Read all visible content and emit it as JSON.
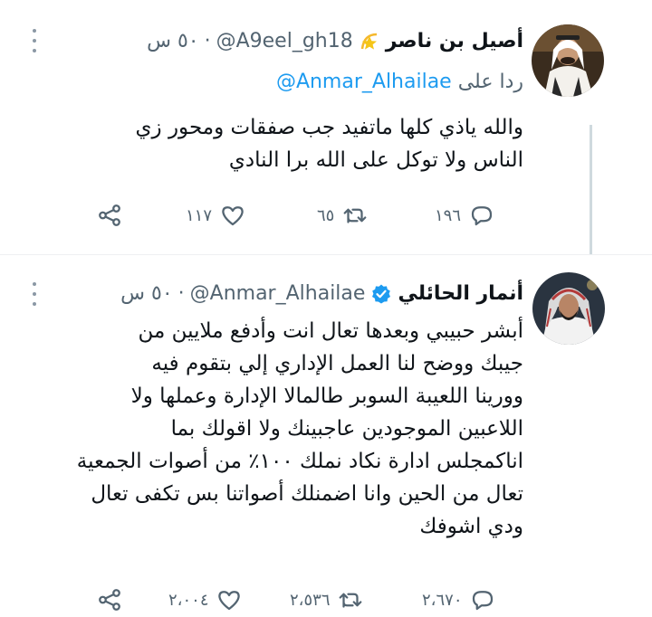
{
  "tweets": [
    {
      "name": "أصيل بن ناصر",
      "badge": "star-emoji-icon",
      "handle": "@A9eel_gh18",
      "separator": "·",
      "time": "٥٠ س",
      "reply_prefix": "ردا على",
      "reply_mention": "@Anmar_Alhailae",
      "text_lines": [
        "والله ياذي كلها ماتفيد جب صفقات ومحور زي",
        "الناس ولا توكل على الله برا النادي"
      ],
      "replies": "١٩٦",
      "retweets": "٦٥",
      "likes": "١١٧"
    },
    {
      "name": "أنمار الحائلي",
      "badge": "verified-badge-icon",
      "handle": "@Anmar_Alhailae",
      "separator": "·",
      "time": "٥٠ س",
      "text_lines": [
        "أبشر حبيبي وبعدها تعال انت وأدفع ملايين من",
        "جيبك ووضح لنا العمل الإداري إلي بتقوم فيه",
        "وورينا اللعيبة السوبر طالمالا الإدارة وعملها ولا",
        "اللاعبين الموجودين عاجبينك ولا اقولك بما",
        "اناكمجلس ادارة نكاد نملك ١٠٠٪ من أصوات الجمعية",
        "تعال من الحين وانا اضمنلك أصواتنا بس تكفى تعال",
        "ودي اشوفك"
      ],
      "replies": "٢،٦٧٠",
      "retweets": "٢،٥٣٦",
      "likes": "٢،٠٠٤"
    }
  ],
  "colors": {
    "accent": "#1d9bf0",
    "secondary_text": "#536471",
    "thread_line": "#cfd9de"
  }
}
